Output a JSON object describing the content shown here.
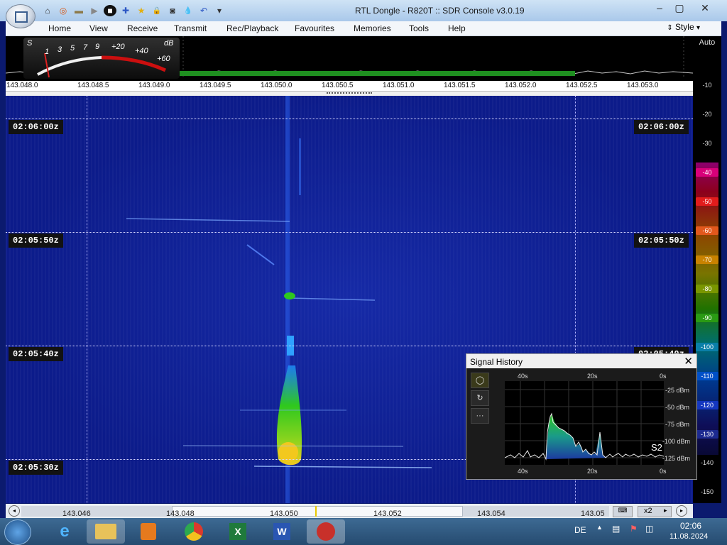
{
  "window": {
    "title": "RTL Dongle - R820T :: SDR Console v3.0.19",
    "controls": {
      "minimize": "‒",
      "maximize": "▢",
      "close": "✕"
    }
  },
  "quick_access": [
    {
      "icon": "home-icon",
      "glyph": "⌂"
    },
    {
      "icon": "lifebuoy-icon",
      "glyph": "◎"
    },
    {
      "icon": "folder-icon",
      "glyph": "▬"
    },
    {
      "icon": "play-icon",
      "glyph": "▶"
    },
    {
      "icon": "stop-icon",
      "glyph": "■"
    },
    {
      "icon": "add-icon",
      "glyph": "✚"
    },
    {
      "icon": "star-icon",
      "glyph": "★"
    },
    {
      "icon": "lock-icon",
      "glyph": "🔒"
    },
    {
      "icon": "camera-icon",
      "glyph": "◙"
    },
    {
      "icon": "drop-icon",
      "glyph": "💧"
    },
    {
      "icon": "undo-icon",
      "glyph": "↶"
    },
    {
      "icon": "dropdown-icon",
      "glyph": "▾"
    }
  ],
  "menu": {
    "items": [
      "Home",
      "View",
      "Receive",
      "Transmit",
      "Rec/Playback",
      "Favourites",
      "Memories",
      "Tools",
      "Help"
    ],
    "style_label": "Style"
  },
  "smeter": {
    "s_label": "S",
    "db_label": "dB",
    "scale": [
      "1",
      "3",
      "5",
      "7",
      "9",
      "+20",
      "+40",
      "+60"
    ]
  },
  "freq_axis": [
    "143.048.0",
    "143.048.5",
    "143.049.0",
    "143.049.5",
    "143.050.0",
    "143.050.5",
    "143.051.0",
    "143.051.5",
    "143.052.0",
    "143.052.5",
    "143.053.0"
  ],
  "waterfall": {
    "time_labels": [
      "02:06:00z",
      "02:05:50z",
      "02:05:40z",
      "02:05:30z"
    ],
    "right_time_labels": [
      "02:06:00z",
      "02:05:50z",
      "02:05:40z"
    ]
  },
  "colour_scale": {
    "mode": "Auto",
    "plain_ticks": [
      "-10",
      "-20",
      "-30"
    ],
    "coloured_ticks": [
      {
        "v": "-40",
        "color": "#d8007a"
      },
      {
        "v": "-50",
        "color": "#e21c1c"
      },
      {
        "v": "-60",
        "color": "#e2581c"
      },
      {
        "v": "-70",
        "color": "#c88200"
      },
      {
        "v": "-80",
        "color": "#7a9600"
      },
      {
        "v": "-90",
        "color": "#2a9a14"
      },
      {
        "v": "-100",
        "color": "#0a7fa8"
      },
      {
        "v": "-110",
        "color": "#0050c8"
      },
      {
        "v": "-120",
        "color": "#1437c0"
      },
      {
        "v": "-130",
        "color": "#1c2a90"
      }
    ],
    "bottom_ticks": [
      "-140",
      "-150"
    ]
  },
  "bottom_bar": {
    "scale": [
      "143.046",
      "143.048",
      "143.050",
      "143.052",
      "143.054",
      "143.05"
    ],
    "zoom": "x2"
  },
  "signal_history": {
    "title": "Signal History",
    "close": "✕",
    "buttons": [
      "◯",
      "↻",
      "···"
    ],
    "x_labels": [
      "40s",
      "20s",
      "0s"
    ],
    "y_labels": [
      "-25 dBm",
      "-50 dBm",
      "-75 dBm",
      "-100 dBm",
      "-125 dBm"
    ],
    "s_reading": "S2"
  },
  "taskbar": {
    "language": "DE",
    "time": "02:06",
    "date": "11.08.2024"
  },
  "colors": {
    "waterfall_bg": "#0c1b8a",
    "signal_green": "#2ec81e",
    "signal_yellow": "#f2d21e"
  }
}
